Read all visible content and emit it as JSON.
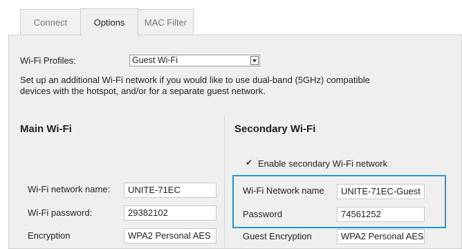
{
  "tabs": [
    {
      "label": "Connect"
    },
    {
      "label": "Options"
    },
    {
      "label": "MAC Filter"
    }
  ],
  "profiles": {
    "label": "Wi-Fi Profiles:",
    "selected": "Guest Wi-Fi"
  },
  "description_line1": "Set up an additional Wi-Fi network if you would like to use dual-band (5GHz) compatible",
  "description_line2": "devices with the hotspot, and/or for a separate guest network.",
  "main": {
    "title": "Main Wi-Fi",
    "network_name_label": "Wi-Fi network name:",
    "network_name_value": "UNITE-71EC",
    "password_label": "Wi-Fi password:",
    "password_value": "29382102",
    "encryption_label": "Encryption",
    "encryption_value": "WPA2 Personal AES"
  },
  "secondary": {
    "title": "Secondary Wi-Fi",
    "enable_label": "Enable secondary Wi-Fi network",
    "enable_checked": true,
    "network_name_label": "Wi-Fi Network name",
    "network_name_value": "UNITE-71EC-Guest",
    "password_label": "Password",
    "password_value": "74561252",
    "encryption_label": "Guest Encryption",
    "encryption_value": "WPA2 Personal AES"
  },
  "colors": {
    "highlight": "#1a9ad8",
    "panel": "#efefef"
  }
}
